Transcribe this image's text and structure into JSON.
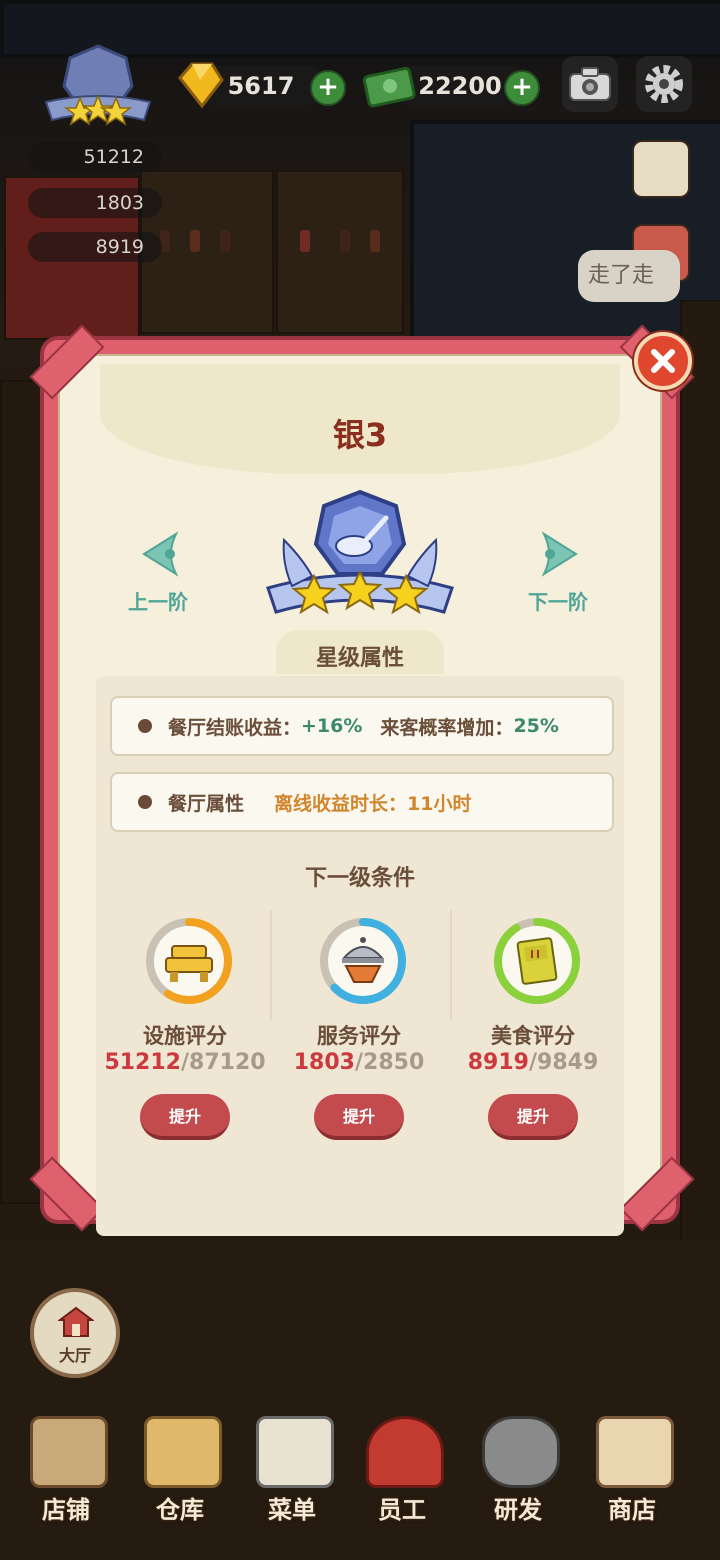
{
  "hud": {
    "gems": "5617",
    "cash": "22200",
    "stats": [
      "51212",
      "1803",
      "8919"
    ],
    "speech_bubble": "走了走"
  },
  "modal": {
    "title": "银3",
    "prev_label": "上一阶",
    "next_label": "下一阶",
    "stars": 3,
    "section_star_attrs": "星级属性",
    "attr_row1": {
      "label_income": "餐厅结账收益：",
      "value_income": "+16%",
      "label_guest": "来客概率增加：",
      "value_guest": "25%"
    },
    "attr_row2": {
      "label": "餐厅属性",
      "offline": "离线收益时长：11小时"
    },
    "section_next": "下一级条件",
    "conditions": [
      {
        "label": "设施评分",
        "current": "51212",
        "target": "/87120",
        "button": "提升",
        "progress": 0.59,
        "color": "#f2a21e",
        "icon": "facility-icon"
      },
      {
        "label": "服务评分",
        "current": "1803",
        "target": "/2850",
        "button": "提升",
        "progress": 0.63,
        "color": "#3fb0e0",
        "icon": "service-icon"
      },
      {
        "label": "美食评分",
        "current": "8919",
        "target": "/9849",
        "button": "提升",
        "progress": 0.91,
        "color": "#8ad13b",
        "icon": "food-icon"
      }
    ]
  },
  "bottom": {
    "lobby": "大厅",
    "nav": [
      "店铺",
      "仓库",
      "菜单",
      "员工",
      "研发",
      "商店"
    ]
  }
}
